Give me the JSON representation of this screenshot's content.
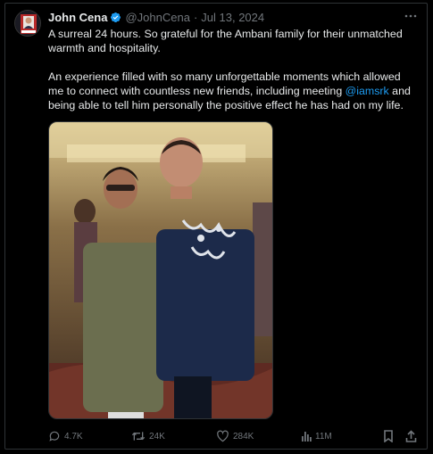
{
  "author": {
    "name": "John Cena",
    "handle": "@JohnCena",
    "date": "Jul 13, 2024"
  },
  "tweet": {
    "line1": "A surreal 24 hours. So grateful for the Ambani family for their unmatched warmth and hospitality.",
    "line2_before": "An experience filled with so many unforgettable moments which allowed me to connect with countless new friends, including meeting ",
    "mention": "@iamsrk",
    "line2_after": " and being able to tell him personally the positive effect he has had on my life."
  },
  "stats": {
    "replies": "4.7K",
    "reposts": "24K",
    "likes": "284K",
    "views": "11M"
  },
  "icons": [
    "verified-badge-icon",
    "more-icon",
    "reply-icon",
    "repost-icon",
    "like-icon",
    "views-icon",
    "bookmark-icon",
    "share-icon"
  ],
  "colors": {
    "accent": "#1d9bf0",
    "text": "#e7e9ea",
    "muted": "#71767b",
    "border": "#2f3336"
  }
}
